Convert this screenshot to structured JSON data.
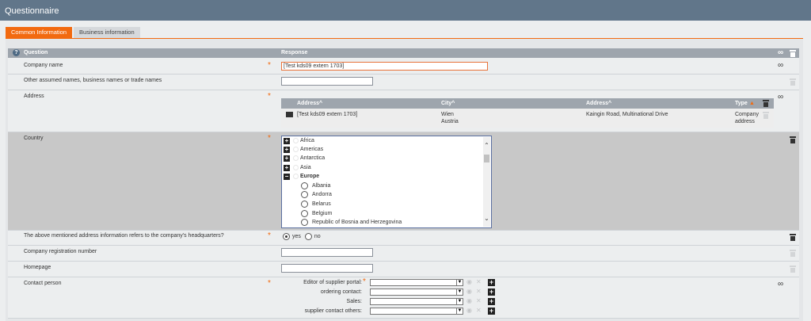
{
  "window": {
    "title": "Questionnaire"
  },
  "tabs": [
    {
      "label": "Common Information",
      "active": true
    },
    {
      "label": "Business information",
      "active": false
    }
  ],
  "table_header": {
    "question": "Question",
    "response": "Response"
  },
  "questions": {
    "company_name": {
      "label": "Company name",
      "value": "[Test kds09 extern 1703]",
      "required": "*"
    },
    "other_names": {
      "label": "Other assumed names, business names or trade names",
      "value": ""
    },
    "address": {
      "label": "Address",
      "required": "*"
    },
    "country": {
      "label": "Country",
      "required": "*"
    },
    "headquarters": {
      "label": "The above mentioned address information refers to the company's headquarters?",
      "required": "*",
      "yes": "yes",
      "no": "no",
      "selected": "yes"
    },
    "registration": {
      "label": "Company registration number",
      "value": ""
    },
    "homepage": {
      "label": "Homepage",
      "value": ""
    },
    "contact": {
      "label": "Contact person",
      "required": "*"
    }
  },
  "address_table": {
    "headers": [
      "Address^",
      "City^",
      "Address^",
      "Type"
    ],
    "row": {
      "name": "[Test kds09 extern 1703]",
      "city": "Wien",
      "country": "Austria",
      "street": "Kaingin Road, Multinational Drive",
      "type_line1": "Company",
      "type_line2": "address"
    }
  },
  "country_tree": {
    "regions": [
      {
        "label": "Africa",
        "expanded": false
      },
      {
        "label": "Americas",
        "expanded": false
      },
      {
        "label": "Antarctica",
        "expanded": false
      },
      {
        "label": "Asia",
        "expanded": false
      },
      {
        "label": "Europe",
        "expanded": true
      }
    ],
    "countries": [
      "Albania",
      "Andorra",
      "Belarus",
      "Belgium",
      "Republic of Bosnia and Herzegovina"
    ]
  },
  "contact_fields": [
    {
      "label": "Editor of supplier portal:",
      "required": "*"
    },
    {
      "label": "ordering contact:"
    },
    {
      "label": "Sales:"
    },
    {
      "label": "supplier contact others:"
    }
  ],
  "colors": {
    "accent": "#f26a10",
    "header": "#61768a",
    "table_header": "#9ea5ad"
  }
}
